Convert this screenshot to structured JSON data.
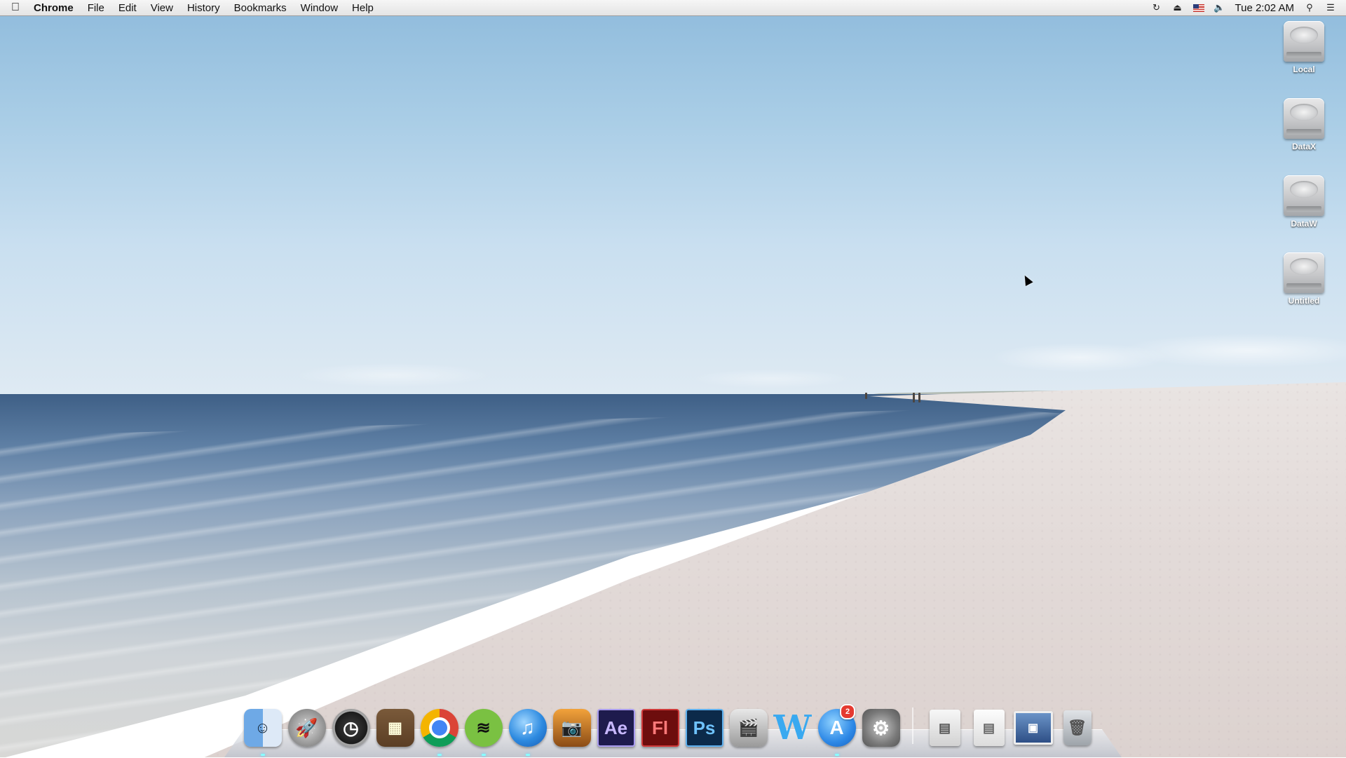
{
  "menubar": {
    "app_name": "Chrome",
    "menus": [
      "File",
      "Edit",
      "View",
      "History",
      "Bookmarks",
      "Window",
      "Help"
    ],
    "clock": "Tue 2:02 AM",
    "status_icons": [
      "time-machine-icon",
      "eject-icon",
      "us-flag-icon",
      "volume-icon",
      "spotlight-icon",
      "notification-center-icon"
    ]
  },
  "desktop": {
    "drives": [
      {
        "label": "Local"
      },
      {
        "label": "DataX"
      },
      {
        "label": "DataW"
      },
      {
        "label": "Untitled"
      }
    ]
  },
  "dock": {
    "apps": [
      {
        "name": "finder",
        "glyph": "☺",
        "running": true
      },
      {
        "name": "launchpad",
        "glyph": "🚀",
        "running": false
      },
      {
        "name": "dashboard",
        "glyph": "◷",
        "running": false
      },
      {
        "name": "preview",
        "glyph": "▦",
        "running": false
      },
      {
        "name": "chrome",
        "glyph": "",
        "running": true
      },
      {
        "name": "spotify",
        "glyph": "≋",
        "running": true
      },
      {
        "name": "itunes",
        "glyph": "♫",
        "running": true
      },
      {
        "name": "iphoto",
        "glyph": "📷",
        "running": false
      },
      {
        "name": "after-effects",
        "glyph": "Ae",
        "running": false
      },
      {
        "name": "flash",
        "glyph": "Fl",
        "running": false
      },
      {
        "name": "photoshop",
        "glyph": "Ps",
        "running": false
      },
      {
        "name": "final-cut",
        "glyph": "🎬",
        "running": false
      },
      {
        "name": "word",
        "glyph": "W",
        "running": false
      },
      {
        "name": "app-store",
        "glyph": "A",
        "running": true,
        "badge": "2"
      },
      {
        "name": "system-preferences",
        "glyph": "⚙",
        "running": false
      }
    ],
    "stacks": [
      {
        "name": "documents",
        "glyph": "▤"
      },
      {
        "name": "downloads",
        "glyph": "▤"
      },
      {
        "name": "screenshot",
        "glyph": "▣"
      },
      {
        "name": "trash",
        "glyph": "🗑"
      }
    ],
    "colors": {
      "badge": "#e53a30",
      "shelf": "#d8dce2"
    }
  }
}
